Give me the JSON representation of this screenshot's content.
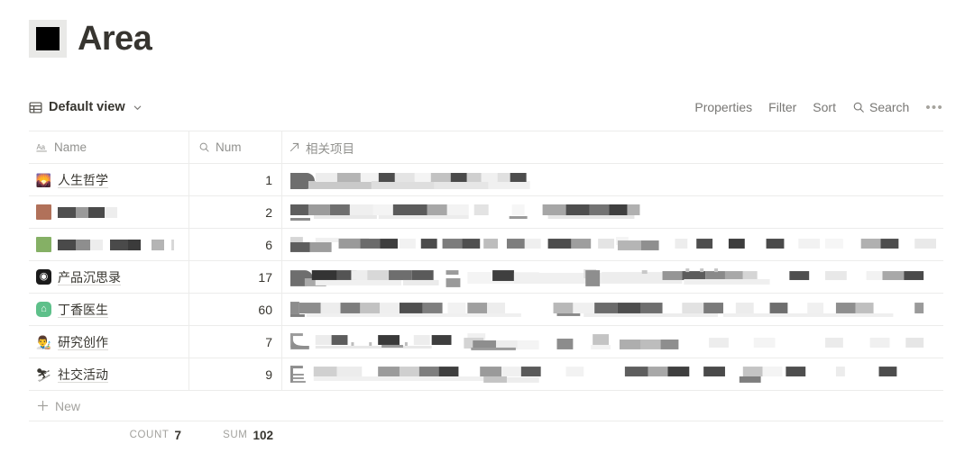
{
  "page": {
    "title": "Area",
    "icon": "black-square-icon"
  },
  "viewbar": {
    "view_name": "Default view",
    "view_icon": "table-icon",
    "chevron": "⌄",
    "tools": [
      {
        "label": "Properties",
        "icon": ""
      },
      {
        "label": "Filter",
        "icon": ""
      },
      {
        "label": "Sort",
        "icon": ""
      },
      {
        "label": "Search",
        "icon": "search-icon"
      }
    ],
    "more_label": "•••"
  },
  "table": {
    "columns": [
      {
        "label": "Name",
        "icon": "text-type-icon",
        "type": "title"
      },
      {
        "label": "Num",
        "icon": "rollup-icon",
        "type": "number"
      },
      {
        "label": "相关项目",
        "icon": "relation-icon",
        "type": "relation"
      }
    ],
    "rows": [
      {
        "icon": "🌄",
        "icon_kind": "emoji",
        "name": "人生哲学",
        "num": "1",
        "relation_redacted": true
      },
      {
        "icon": "",
        "icon_kind": "color",
        "icon_color": "#b1715a",
        "name": "",
        "name_redacted": true,
        "num": "2",
        "relation_redacted": true
      },
      {
        "icon": "",
        "icon_kind": "color",
        "icon_color": "#85b065",
        "name": "",
        "name_redacted": true,
        "num": "6",
        "relation_redacted": true
      },
      {
        "icon": "◉",
        "icon_kind": "app-dark",
        "name": "产品沉思录",
        "num": "17",
        "relation_redacted": true
      },
      {
        "icon": "⌂",
        "icon_kind": "app-green",
        "name": "丁香医生",
        "num": "60",
        "relation_redacted": true
      },
      {
        "icon": "👨‍🎨",
        "icon_kind": "emoji",
        "name": "研究创作",
        "num": "7",
        "relation_redacted": true
      },
      {
        "icon": "⛷",
        "icon_kind": "emoji",
        "name": "社交活动",
        "num": "9",
        "relation_redacted": true
      }
    ],
    "new_row_label": "New",
    "aggregates": {
      "count_label": "COUNT",
      "count_value": "7",
      "sum_label": "SUM",
      "sum_value": "102"
    }
  },
  "colors": {
    "text": "#37352f",
    "muted": "#91918e",
    "border": "#ececeb",
    "icon_brown": "#b1715a",
    "icon_green": "#85b065"
  }
}
